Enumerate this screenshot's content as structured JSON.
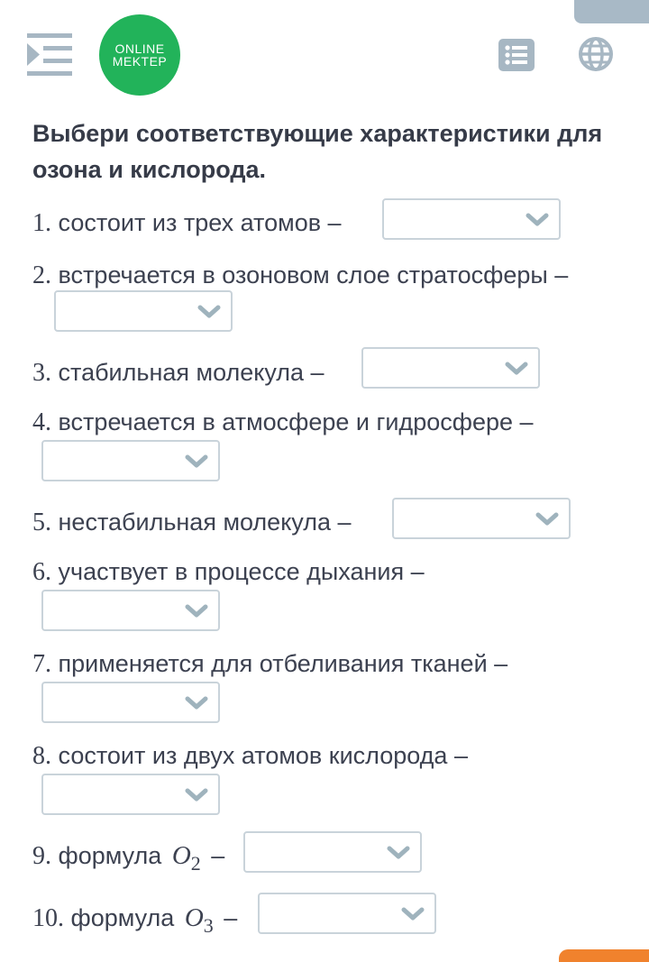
{
  "header": {
    "logo_line1": "ONLINE",
    "logo_line2": "MEKTEP",
    "icons": [
      "menu-collapse-icon",
      "list-icon",
      "globe-icon"
    ],
    "colors": {
      "logo": "#22b35a",
      "icons": "#a7b7c3",
      "accent": "#f0822d"
    }
  },
  "task": {
    "title": "Выбери соответствующие характеристики для озона и кислорода."
  },
  "questions": [
    {
      "num": "1.",
      "text": "состоит из трех атомов –",
      "selected": ""
    },
    {
      "num": "2.",
      "text": "встречается в озоновом слое стратосферы –",
      "selected": ""
    },
    {
      "num": "3.",
      "text": "стабильная молекула –",
      "selected": ""
    },
    {
      "num": "4.",
      "text": "встречается в атмосфере и гидросфере –",
      "selected": ""
    },
    {
      "num": "5.",
      "text": "нестабильная молекула –",
      "selected": ""
    },
    {
      "num": "6.",
      "text": "участвует в процессе дыхания –",
      "selected": ""
    },
    {
      "num": "7.",
      "text": "применяется для отбеливания тканей –",
      "selected": ""
    },
    {
      "num": "8.",
      "text": "состоит из двух атомов кислорода –",
      "selected": ""
    },
    {
      "num": "9.",
      "text": "формула",
      "formula": "O",
      "sub": "2",
      "dash": "–",
      "selected": ""
    },
    {
      "num": "10.",
      "text": "формула",
      "formula": "O",
      "sub": "3",
      "dash": "–",
      "selected": ""
    }
  ]
}
